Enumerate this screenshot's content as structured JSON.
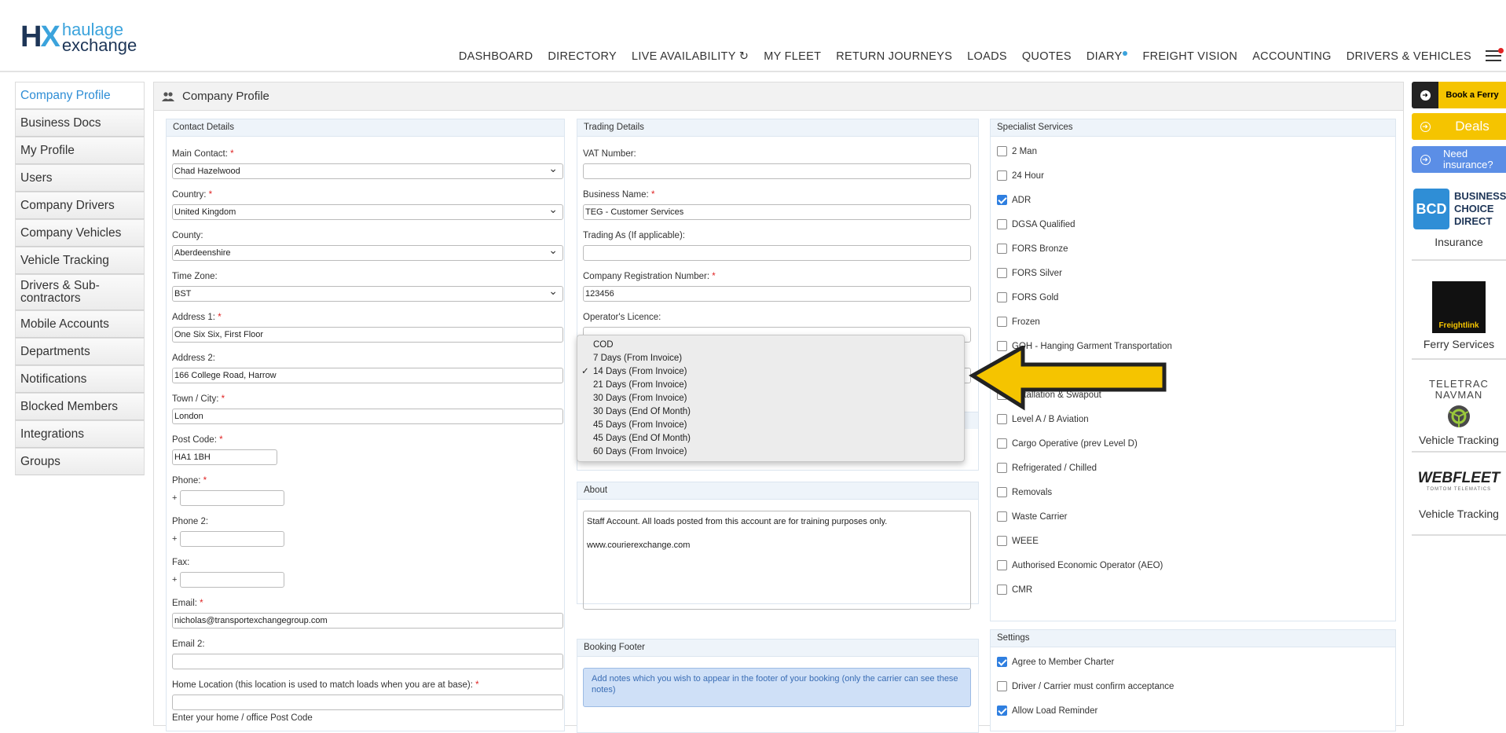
{
  "logo": {
    "hx_h": "H",
    "hx_x": "X",
    "line1": "haulage",
    "line2": "exchange"
  },
  "nav": [
    "DASHBOARD",
    "DIRECTORY",
    "LIVE AVAILABILITY",
    "MY FLEET",
    "RETURN JOURNEYS",
    "LOADS",
    "QUOTES",
    "DIARY",
    "FREIGHT VISION",
    "ACCOUNTING",
    "DRIVERS & VEHICLES"
  ],
  "sidebar": [
    "Company Profile",
    "Business Docs",
    "My Profile",
    "Users",
    "Company Drivers",
    "Company Vehicles",
    "Vehicle Tracking",
    "Drivers & Sub-contractors",
    "Mobile Accounts",
    "Departments",
    "Notifications",
    "Blocked Members",
    "Integrations",
    "Groups"
  ],
  "page_title": "Company Profile",
  "contact": {
    "title": "Contact Details",
    "main_contact_label": "Main Contact:",
    "main_contact": "Chad Hazelwood",
    "country_label": "Country:",
    "country": "United Kingdom",
    "county_label": "County:",
    "county": "Aberdeenshire",
    "timezone_label": "Time Zone:",
    "timezone": "BST",
    "address1_label": "Address 1:",
    "address1": "One Six Six, First Floor",
    "address2_label": "Address 2:",
    "address2": "166 College Road, Harrow",
    "town_label": "Town / City:",
    "town": "London",
    "postcode_label": "Post Code:",
    "postcode": "HA1 1BH",
    "phone_label": "Phone:",
    "phone2_label": "Phone 2:",
    "fax_label": "Fax:",
    "plus": "+",
    "email_label": "Email:",
    "email": "nicholas@transportexchangegroup.com",
    "email2_label": "Email 2:",
    "home_label": "Home Location (this location is used to match loads when you are at base):",
    "home_hint": "Enter your home / office Post Code"
  },
  "trading": {
    "title": "Trading Details",
    "vat_label": "VAT Number:",
    "business_label": "Business Name:",
    "business": "TEG - Customer Services",
    "trading_as_label": "Trading As (If applicable):",
    "reg_label": "Company Registration Number:",
    "reg": "123456",
    "operator_label": "Operator's Licence:"
  },
  "payment_terms": {
    "options": [
      "COD",
      "7 Days (From Invoice)",
      "14 Days (From Invoice)",
      "21 Days (From Invoice)",
      "30 Days (From Invoice)",
      "30 Days (End Of Month)",
      "45 Days (From Invoice)",
      "45 Days (End Of Month)",
      "60 Days (From Invoice)"
    ],
    "selected": "14 Days (From Invoice)"
  },
  "about": {
    "title": "About",
    "line1": "Staff Account. All loads posted from this account are for training purposes only.",
    "line2": "www.courierexchange.com"
  },
  "booking_footer": {
    "title": "Booking Footer",
    "notice": "Add notes which you wish to appear in the footer of your booking (only the carrier can see these notes)"
  },
  "specialist": {
    "title": "Specialist Services",
    "items": [
      {
        "label": "2 Man",
        "checked": false
      },
      {
        "label": "24 Hour",
        "checked": false
      },
      {
        "label": "ADR",
        "checked": true
      },
      {
        "label": "DGSA Qualified",
        "checked": false
      },
      {
        "label": "FORS Bronze",
        "checked": false
      },
      {
        "label": "FORS Silver",
        "checked": false
      },
      {
        "label": "FORS Gold",
        "checked": false
      },
      {
        "label": "Frozen",
        "checked": false
      },
      {
        "label": "GOH - Hanging Garment Transportation",
        "checked": false
      },
      {
        "label": "",
        "checked": false
      },
      {
        "label": "Installation & Swapout",
        "checked": false
      },
      {
        "label": "Level A / B Aviation",
        "checked": false
      },
      {
        "label": "Cargo Operative (prev Level D)",
        "checked": false
      },
      {
        "label": "Refrigerated / Chilled",
        "checked": false
      },
      {
        "label": "Removals",
        "checked": false
      },
      {
        "label": "Waste Carrier",
        "checked": false
      },
      {
        "label": "WEEE",
        "checked": false
      },
      {
        "label": "Authorised Economic Operator (AEO)",
        "checked": false
      },
      {
        "label": "CMR",
        "checked": false
      }
    ]
  },
  "settings": {
    "title": "Settings",
    "items": [
      {
        "label": "Agree to Member Charter",
        "checked": true
      },
      {
        "label": "Driver / Carrier must confirm acceptance",
        "checked": false
      },
      {
        "label": "Allow Load Reminder",
        "checked": true
      }
    ]
  },
  "ads": {
    "ferry": "Book a Ferry",
    "deals": "Deals",
    "insurance": "Need insurance?",
    "bcd_logo": "BCD",
    "bcd_text": "BUSINESS CHOICE DIRECT",
    "insurance_label": "Insurance",
    "freightlink": "Freightlink",
    "ferry_services": "Ferry Services",
    "teletrac": "TELETRAC NAVMAN",
    "vehicle_tracking_1": "Vehicle Tracking",
    "webfleet": "WEBFLEET",
    "webfleet_sub": "TOMTOM TELEMATICS",
    "vehicle_tracking_2": "Vehicle Tracking"
  },
  "colors": {
    "accent": "#2f8ed6",
    "arrow": "#f5c400",
    "deals": "#f5c400",
    "insurance": "#5b8ee6"
  }
}
